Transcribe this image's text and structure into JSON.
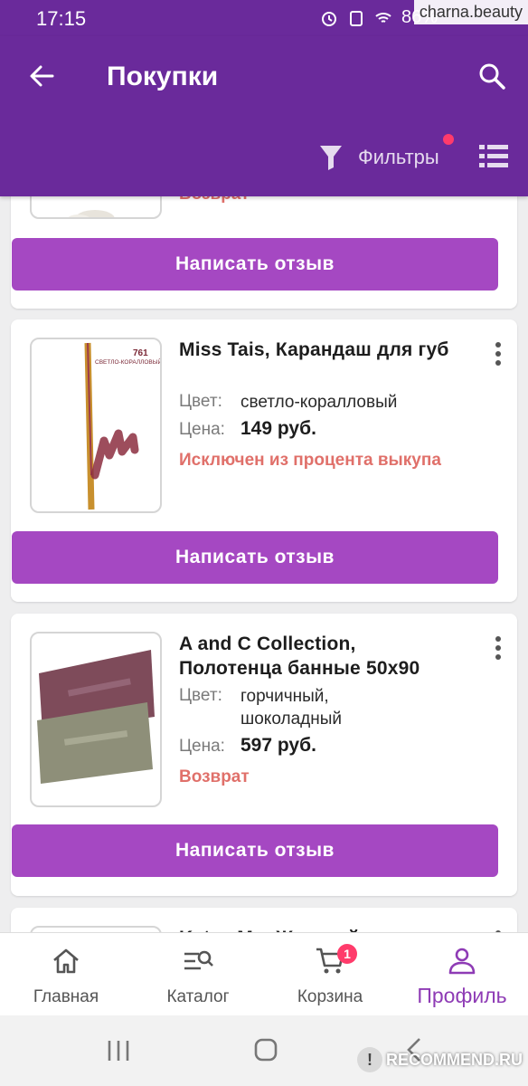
{
  "status_bar": {
    "time": "17:15",
    "battery": "86%",
    "watermark": "charna.beauty"
  },
  "header": {
    "title": "Покупки",
    "filters_label": "Фильтры"
  },
  "cards": [
    {
      "status": "Возврат",
      "review_button": "Написать отзыв"
    },
    {
      "name": "Miss Tais, Карандаш для губ",
      "color_label": "Цвет:",
      "color_value": "светло-коралловый",
      "price_label": "Цена:",
      "price_value": "149 руб.",
      "status": "Исключен из процента выкупа",
      "review_button": "Написать отзыв",
      "thumb_text_number": "761",
      "thumb_text_name": "СВЕТЛО-КОРАЛЛОВЫЙ"
    },
    {
      "name": "A and C Collection, Полотенца банные 50x90",
      "color_label": "Цвет:",
      "color_value": "горчичный, шоколадный",
      "price_label": "Цена:",
      "price_value": "597 руб.",
      "status": "Возврат",
      "review_button": "Написать отзыв"
    },
    {
      "name": "Katya Mo, Женский"
    }
  ],
  "bottom_nav": {
    "items": [
      {
        "label": "Главная",
        "icon": "home-icon"
      },
      {
        "label": "Каталог",
        "icon": "catalog-search-icon"
      },
      {
        "label": "Корзина",
        "icon": "cart-icon",
        "badge": "1"
      },
      {
        "label": "Профиль",
        "icon": "profile-icon",
        "active": true
      }
    ]
  },
  "watermark_bottom": "RECOMMEND.RU",
  "colors": {
    "primary": "#6a2a9b",
    "button": "#a548c2",
    "status_red": "#e0706a",
    "badge": "#ff3b6b",
    "active_nav": "#8e3bb5"
  }
}
